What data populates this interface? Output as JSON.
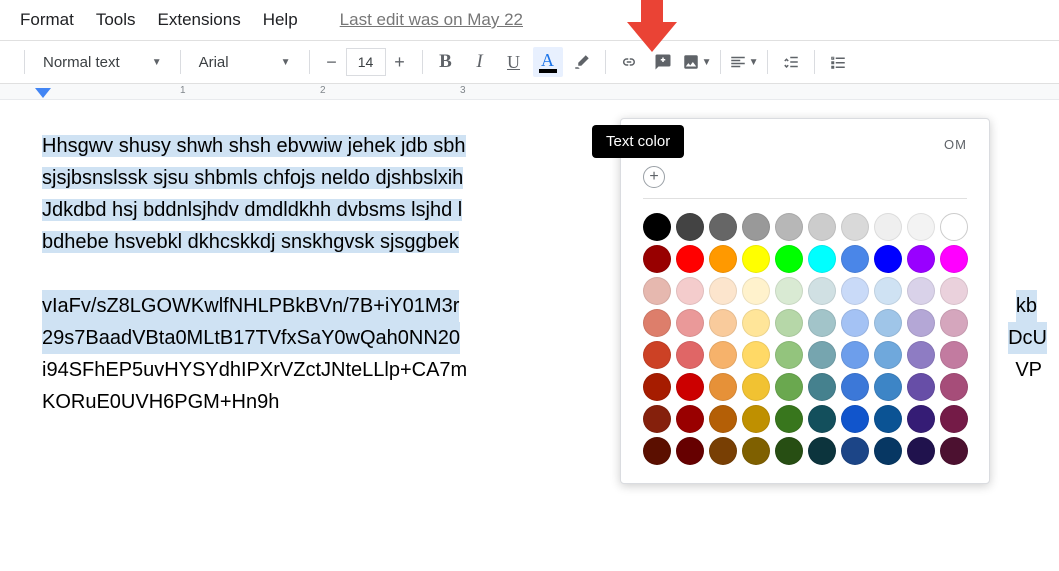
{
  "menu": {
    "format": "Format",
    "tools": "Tools",
    "extensions": "Extensions",
    "help": "Help",
    "last_edit": "Last edit was on May 22"
  },
  "toolbar": {
    "styles": "Normal text",
    "font": "Arial",
    "font_size": "14",
    "tooltip": "Text color"
  },
  "ruler": {
    "nums": [
      "1",
      "2",
      "3"
    ]
  },
  "popup": {
    "header_tail": "OM"
  },
  "palette": [
    [
      "#000000",
      "#434343",
      "#666666",
      "#999999",
      "#b7b7b7",
      "#cccccc",
      "#d9d9d9",
      "#efefef",
      "#f3f3f3",
      "#ffffff"
    ],
    [
      "#980000",
      "#ff0000",
      "#ff9900",
      "#ffff00",
      "#00ff00",
      "#00ffff",
      "#4a86e8",
      "#0000ff",
      "#9900ff",
      "#ff00ff"
    ],
    [
      "#e6b8af",
      "#f4cccc",
      "#fce5cd",
      "#fff2cc",
      "#d9ead3",
      "#d0e0e3",
      "#c9daf8",
      "#cfe2f3",
      "#d9d2e9",
      "#ead1dc"
    ],
    [
      "#dd7e6b",
      "#ea9999",
      "#f9cb9c",
      "#ffe599",
      "#b6d7a8",
      "#a2c4c9",
      "#a4c2f4",
      "#9fc5e8",
      "#b4a7d6",
      "#d5a6bd"
    ],
    [
      "#cc4125",
      "#e06666",
      "#f6b26b",
      "#ffd966",
      "#93c47d",
      "#76a5af",
      "#6d9eeb",
      "#6fa8dc",
      "#8e7cc3",
      "#c27ba0"
    ],
    [
      "#a61c00",
      "#cc0000",
      "#e69138",
      "#f1c232",
      "#6aa84f",
      "#45818e",
      "#3c78d8",
      "#3d85c6",
      "#674ea7",
      "#a64d79"
    ],
    [
      "#85200c",
      "#990000",
      "#b45f06",
      "#bf9000",
      "#38761d",
      "#134f5c",
      "#1155cc",
      "#0b5394",
      "#351c75",
      "#741b47"
    ],
    [
      "#5b0f00",
      "#660000",
      "#783f04",
      "#7f6000",
      "#274e13",
      "#0c343d",
      "#1c4587",
      "#073763",
      "#20124d",
      "#4c1130"
    ]
  ],
  "doc": {
    "l1": "Hhsgwv shusy shwh shsh ebvwiw jehek jdb sbh",
    "l2": "sjsjbsnslssk sjsu shbmls chfojs neldo djshbslxih",
    "l3": "Jdkdbd hsj bddnlsjhdv dmdldkhh dvbsms lsjhd l",
    "l4": "bdhebe hsvebkl dkhcskkdj snskhgvsk sjsggbek",
    "l5a": "vIaFv/sZ8LGOWKwlfNHLPBkBVn/7B+iY01M3r",
    "l5b": "kb",
    "l6a": "29s7BaadVBta0MLtB17TVfxSaY0wQah0NN20",
    "l6b": "DcU",
    "l7a": "i94SFhEP5uvHYSYdhIPXrVZctJNteLLlp+CA7m",
    "l7b": "VP",
    "l8": "KORuE0UVH6PGM+Hn9h"
  }
}
